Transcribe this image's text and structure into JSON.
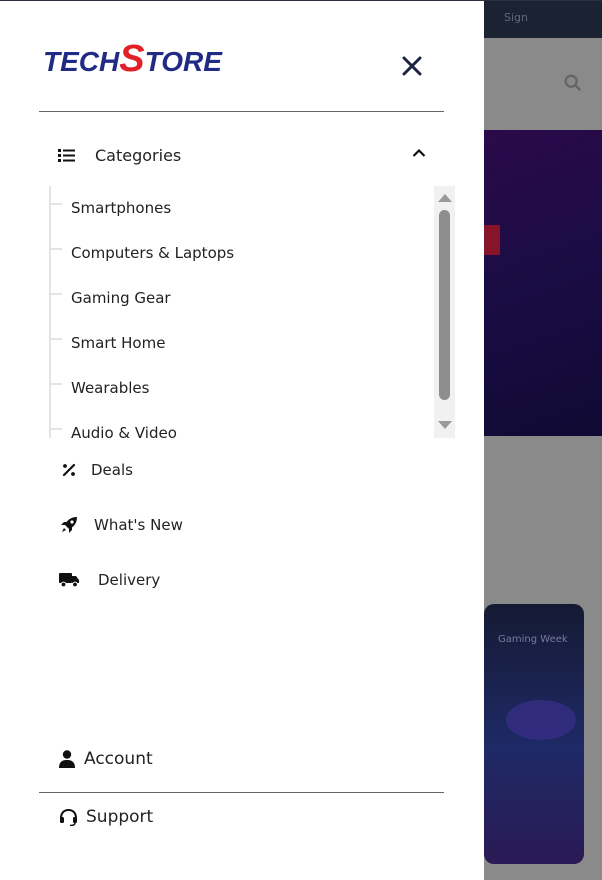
{
  "brand": {
    "logo_part1": "TECH",
    "logo_s": "S",
    "logo_part2": "TORE",
    "colors": {
      "primary": "#212b86",
      "accent": "#e12027"
    }
  },
  "drawer": {
    "close_icon": "close-icon",
    "categories": {
      "label": "Categories",
      "icon": "list-icon",
      "expanded": true,
      "items": [
        {
          "label": "Smartphones"
        },
        {
          "label": "Computers & Laptops"
        },
        {
          "label": "Gaming Gear"
        },
        {
          "label": "Smart Home"
        },
        {
          "label": "Wearables"
        },
        {
          "label": "Audio & Video"
        }
      ]
    },
    "nav": [
      {
        "label": "Deals",
        "icon": "percent-icon"
      },
      {
        "label": "What's New",
        "icon": "rocket-icon"
      },
      {
        "label": "Delivery",
        "icon": "truck-icon"
      }
    ],
    "footer": [
      {
        "label": "Account",
        "icon": "user-icon"
      },
      {
        "label": "Support",
        "icon": "headset-icon"
      }
    ]
  },
  "background": {
    "topbar_text": "Sign",
    "card_text": "Gaming Week"
  }
}
